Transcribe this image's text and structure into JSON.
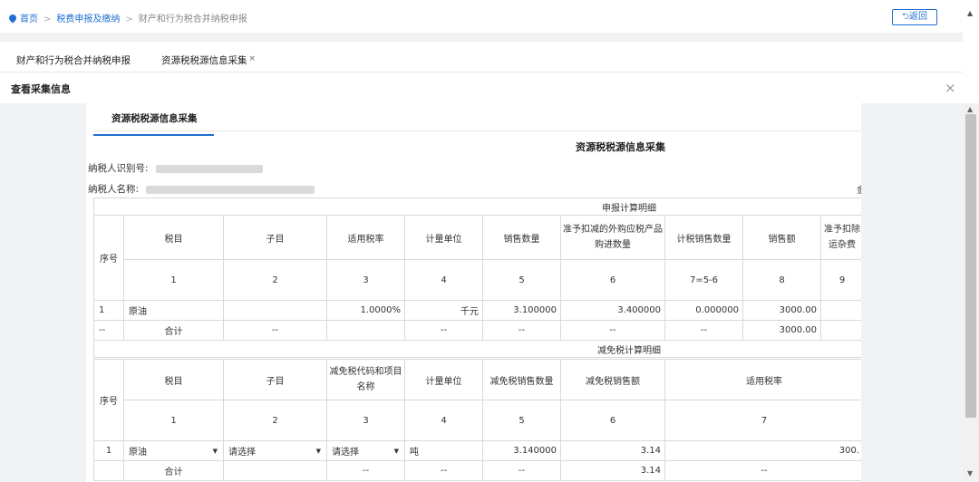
{
  "breadcrumb": {
    "home": "首页",
    "level1": "税费申报及缴纳",
    "level2": "财产和行为税合并纳税申报"
  },
  "back_button": "返回",
  "tabs": [
    {
      "label": "财产和行为税合并纳税申报"
    },
    {
      "label": "资源税税源信息采集",
      "close": "×"
    }
  ],
  "panel": {
    "title": "查看采集信息",
    "close": "×"
  },
  "sheet": {
    "subtab": "资源税税源信息采集",
    "title": "资源税税源信息采集",
    "taxpayer_id_label": "纳税人识别号:",
    "taxpayer_name_label": "纳税人名称:",
    "edge_char": "金"
  },
  "table1": {
    "section_title": "申报计算明细",
    "headers": [
      "序号",
      "税目",
      "子目",
      "适用税率",
      "计量单位",
      "销售数量",
      "准予扣减的外购应税产品购进数量",
      "计税销售数量",
      "销售额",
      "准予扣除运杂费"
    ],
    "col_numbers": [
      "1",
      "2",
      "3",
      "4",
      "5",
      "6",
      "7=5-6",
      "8",
      "9"
    ],
    "rows": [
      [
        "1",
        "原油",
        "",
        "1.0000%",
        "千元",
        "3.100000",
        "3.400000",
        "0.000000",
        "3000.00",
        ""
      ],
      [
        "--",
        "合计",
        "--",
        "",
        "--",
        "--",
        "--",
        "--",
        "3000.00",
        ""
      ]
    ]
  },
  "table2": {
    "section_title": "减免税计算明细",
    "headers": [
      "序号",
      "税目",
      "子目",
      "减免税代码和项目名称",
      "计量单位",
      "减免税销售数量",
      "减免税销售额",
      "适用税率"
    ],
    "col_numbers": [
      "1",
      "2",
      "3",
      "4",
      "5",
      "6",
      "7"
    ],
    "row": {
      "seq": "1",
      "item": "原油",
      "subitem": "请选择",
      "code": "请选择",
      "unit": "吨",
      "qty": "3.140000",
      "amount": "3.14",
      "rate_partial": "300."
    },
    "total": [
      "",
      "合计",
      "",
      "--",
      "--",
      "--",
      "3.14",
      "--"
    ]
  },
  "colors": {
    "accent": "#1f6fd1",
    "border": "#d9d9d9",
    "gray_bg": "#f1f2f4"
  },
  "icons": [
    "location-pin-icon",
    "return-icon",
    "close-icon",
    "dropdown-caret-icon"
  ]
}
